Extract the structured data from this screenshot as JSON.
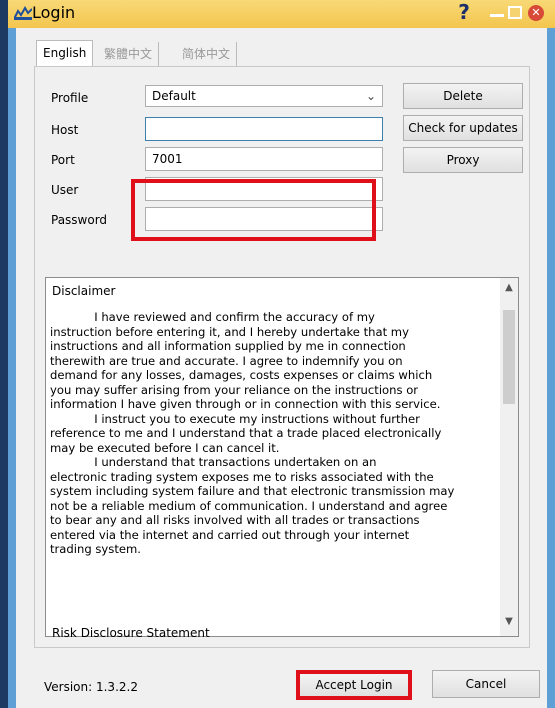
{
  "window": {
    "title": "Login",
    "help": "?"
  },
  "tabs": [
    {
      "label": "English",
      "active": true
    },
    {
      "label": "繁體中文",
      "active": false
    },
    {
      "label": "简体中文",
      "active": false
    }
  ],
  "form": {
    "profile_label": "Profile",
    "profile_value": "Default",
    "host_label": "Host",
    "host_value": "",
    "port_label": "Port",
    "port_value": "7001",
    "user_label": "User",
    "user_value": "",
    "password_label": "Password",
    "password_value": ""
  },
  "buttons": {
    "delete": "Delete",
    "check_updates": "Check for updates",
    "proxy": "Proxy",
    "accept_login": "Accept Login",
    "cancel": "Cancel"
  },
  "disclaimer": {
    "title": "Disclaimer",
    "text": "            I have reviewed and confirm the accuracy of my\ninstruction before entering it, and I hereby undertake that my\ninstructions and all information supplied by me in connection\ntherewith are true and accurate. I agree to indemnify you on\ndemand for any losses, damages, costs expenses or claims which\nyou may suffer arising from your reliance on the instructions or\ninformation I have given through or in connection with this service.\n            I instruct you to execute my instructions without further\nreference to me and I understand that a trade placed electronically\nmay be executed before I can cancel it.\n            I understand that transactions undertaken on an\nelectronic trading system exposes me to risks associated with the\nsystem including system failure and that electronic transmission may\nnot be a reliable medium of communication. I understand and agree\nto bear any and all risks involved with all trades or transactions\nentered via the internet and carried out through your internet\ntrading system.",
    "risk_heading": "Risk Disclosure Statement"
  },
  "footer": {
    "version": "Version: 1.3.2.2"
  },
  "icons": {
    "close": "close-icon",
    "minimize": "minimize-icon",
    "maximize": "maximize-icon",
    "help": "help-icon"
  }
}
